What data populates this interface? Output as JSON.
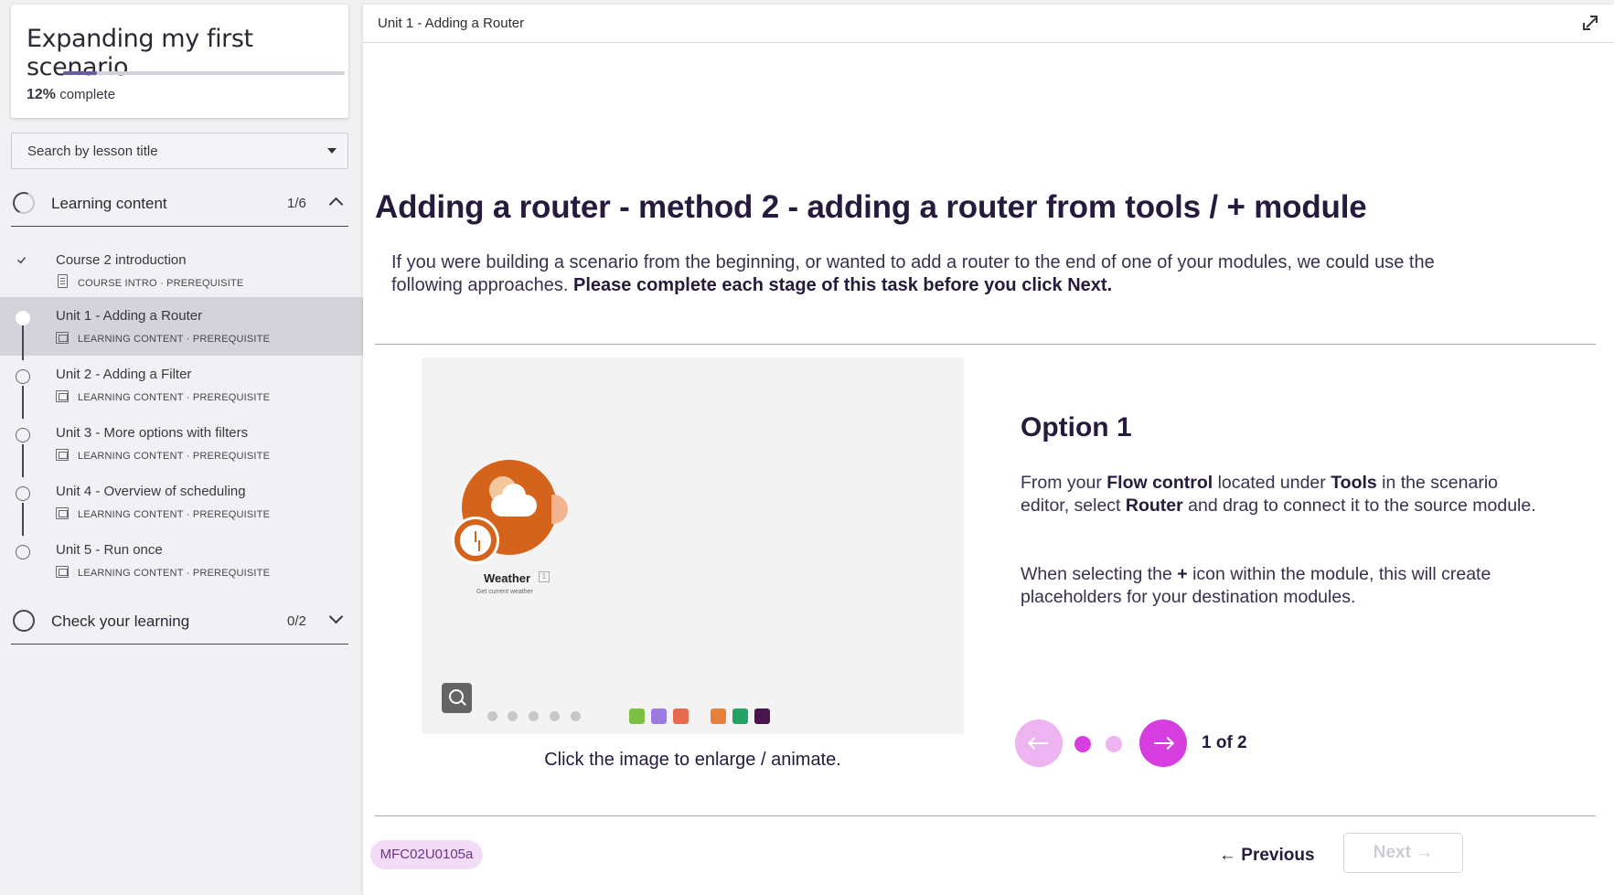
{
  "sidebar": {
    "course_title": "Expanding my first scenario",
    "progress_percent": "12%",
    "progress_suffix": "complete",
    "progress_fraction": 0.12,
    "search_placeholder": "Search by lesson title",
    "sections": [
      {
        "title": "Learning content",
        "count": "1/6",
        "expanded": true
      },
      {
        "title": "Check your learning",
        "count": "0/2",
        "expanded": false
      }
    ],
    "lessons": [
      {
        "title": "Course 2 introduction",
        "meta": "COURSE INTRO · PREREQUISITE",
        "state": "completed"
      },
      {
        "title": "Unit 1 - Adding a Router",
        "meta": "LEARNING CONTENT · PREREQUISITE",
        "state": "active"
      },
      {
        "title": "Unit 2 - Adding a Filter",
        "meta": "LEARNING CONTENT · PREREQUISITE",
        "state": "pending"
      },
      {
        "title": "Unit 3 - More options with filters",
        "meta": "LEARNING CONTENT · PREREQUISITE",
        "state": "pending"
      },
      {
        "title": "Unit 4 - Overview of scheduling",
        "meta": "LEARNING CONTENT · PREREQUISITE",
        "state": "pending"
      },
      {
        "title": "Unit 5 - Run once",
        "meta": "LEARNING CONTENT · PREREQUISITE",
        "state": "pending"
      }
    ]
  },
  "main": {
    "breadcrumb": "Unit 1 - Adding a Router",
    "title": "Adding a router - method 2 - adding a router from tools / + module",
    "intro_text": "If you were building a scenario from the beginning, or wanted to add a router to the end of one of your modules, we could use the following approaches. ",
    "intro_bold": "Please complete each stage of this task before you click Next.",
    "image": {
      "module_label": "Weather",
      "module_badge": "1",
      "module_sub": "Get current weather",
      "caption": "Click the image to enlarge / animate."
    },
    "option": {
      "title": "Option 1",
      "p1_a": "From your ",
      "p1_b": "Flow control",
      "p1_c": " located under ",
      "p1_d": "Tools",
      "p1_e": " in the scenario editor, select ",
      "p1_f": "Router",
      "p1_g": " and drag to connect it to the source module.",
      "p2_a": "When selecting the ",
      "p2_b": "+",
      "p2_c": " icon within the module, this will create placeholders for your destination modules."
    },
    "pager": {
      "current": 1,
      "total": 2,
      "label": "1 of 2"
    },
    "code": "MFC02U0105a",
    "prev_label": "Previous",
    "next_label": "Next"
  },
  "colors": {
    "accent": "#d63ee0",
    "accent_light": "#eeb3f1",
    "heading": "#261a3d",
    "weather_module": "#d4641c"
  }
}
